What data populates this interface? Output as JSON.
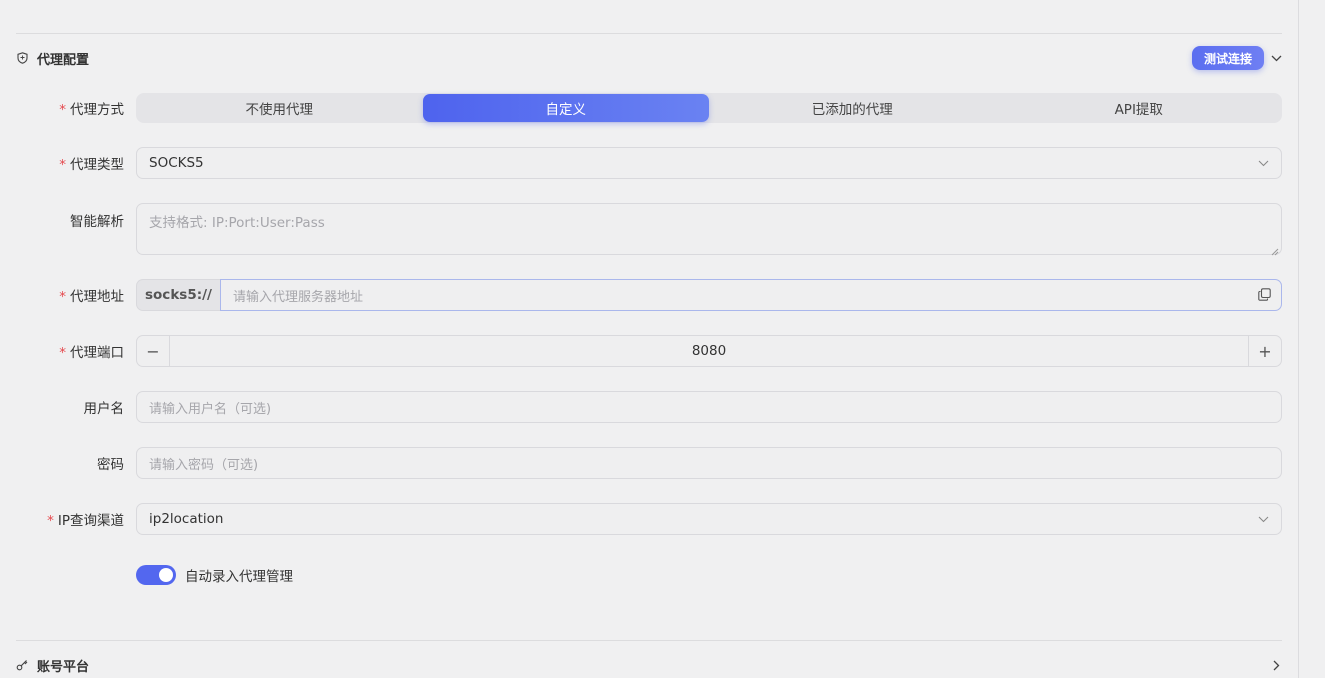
{
  "proxy_section": {
    "title": "代理配置",
    "test_button": "测试连接"
  },
  "form": {
    "mode": {
      "label": "代理方式",
      "required": true,
      "options": [
        "不使用代理",
        "自定义",
        "已添加的代理",
        "API提取"
      ],
      "selected": "自定义"
    },
    "type": {
      "label": "代理类型",
      "required": true,
      "value": "SOCKS5"
    },
    "smart_parse": {
      "label": "智能解析",
      "placeholder": "支持格式: IP:Port:User:Pass"
    },
    "address": {
      "label": "代理地址",
      "required": true,
      "prefix": "socks5://",
      "placeholder": "请输入代理服务器地址"
    },
    "port": {
      "label": "代理端口",
      "required": true,
      "value": "8080",
      "minus": "−",
      "plus": "+"
    },
    "username": {
      "label": "用户名",
      "placeholder": "请输入用户名（可选)"
    },
    "password": {
      "label": "密码",
      "placeholder": "请输入密码（可选)"
    },
    "ip_channel": {
      "label": "IP查询渠道",
      "required": true,
      "value": "ip2location"
    },
    "auto_import": {
      "label": "自动录入代理管理",
      "enabled": true
    }
  },
  "account_section": {
    "title": "账号平台"
  },
  "required_mark": "*",
  "icons": {
    "proxy_section": "shield-icon",
    "account_section": "key-icon",
    "collapse": "chevron-down-icon",
    "expand": "chevron-right-icon",
    "select": "chevron-down-icon",
    "copy": "copy-icon"
  },
  "colors": {
    "accent": "#5367ef",
    "required": "#e5484d",
    "background": "#f0f0f1"
  }
}
